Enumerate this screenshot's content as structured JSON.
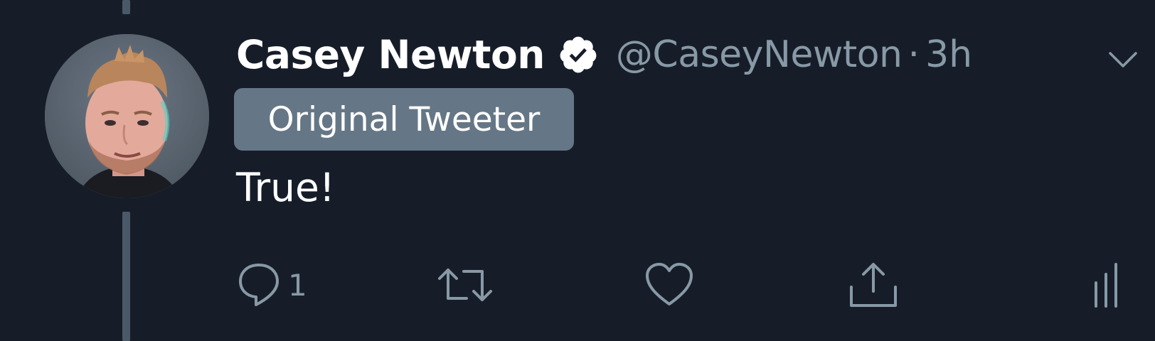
{
  "tweet": {
    "author": {
      "display_name": "Casey Newton",
      "handle": "@CaseyNewton",
      "verified": true,
      "avatar_icon": "avatar-photo"
    },
    "separator": "·",
    "time": "3h",
    "badge": "Original Tweeter",
    "text": "True!",
    "actions": {
      "reply_count": "1"
    }
  },
  "colors": {
    "background": "#161d29",
    "text_primary": "#ffffff",
    "text_secondary": "#8899a6",
    "badge_bg": "#657786",
    "thread_line": "#4a5967"
  },
  "icons": {
    "verified": "verified-badge-icon",
    "menu": "chevron-down-icon",
    "reply": "reply-icon",
    "retweet": "retweet-icon",
    "like": "heart-icon",
    "share": "share-icon",
    "analytics": "analytics-icon"
  }
}
